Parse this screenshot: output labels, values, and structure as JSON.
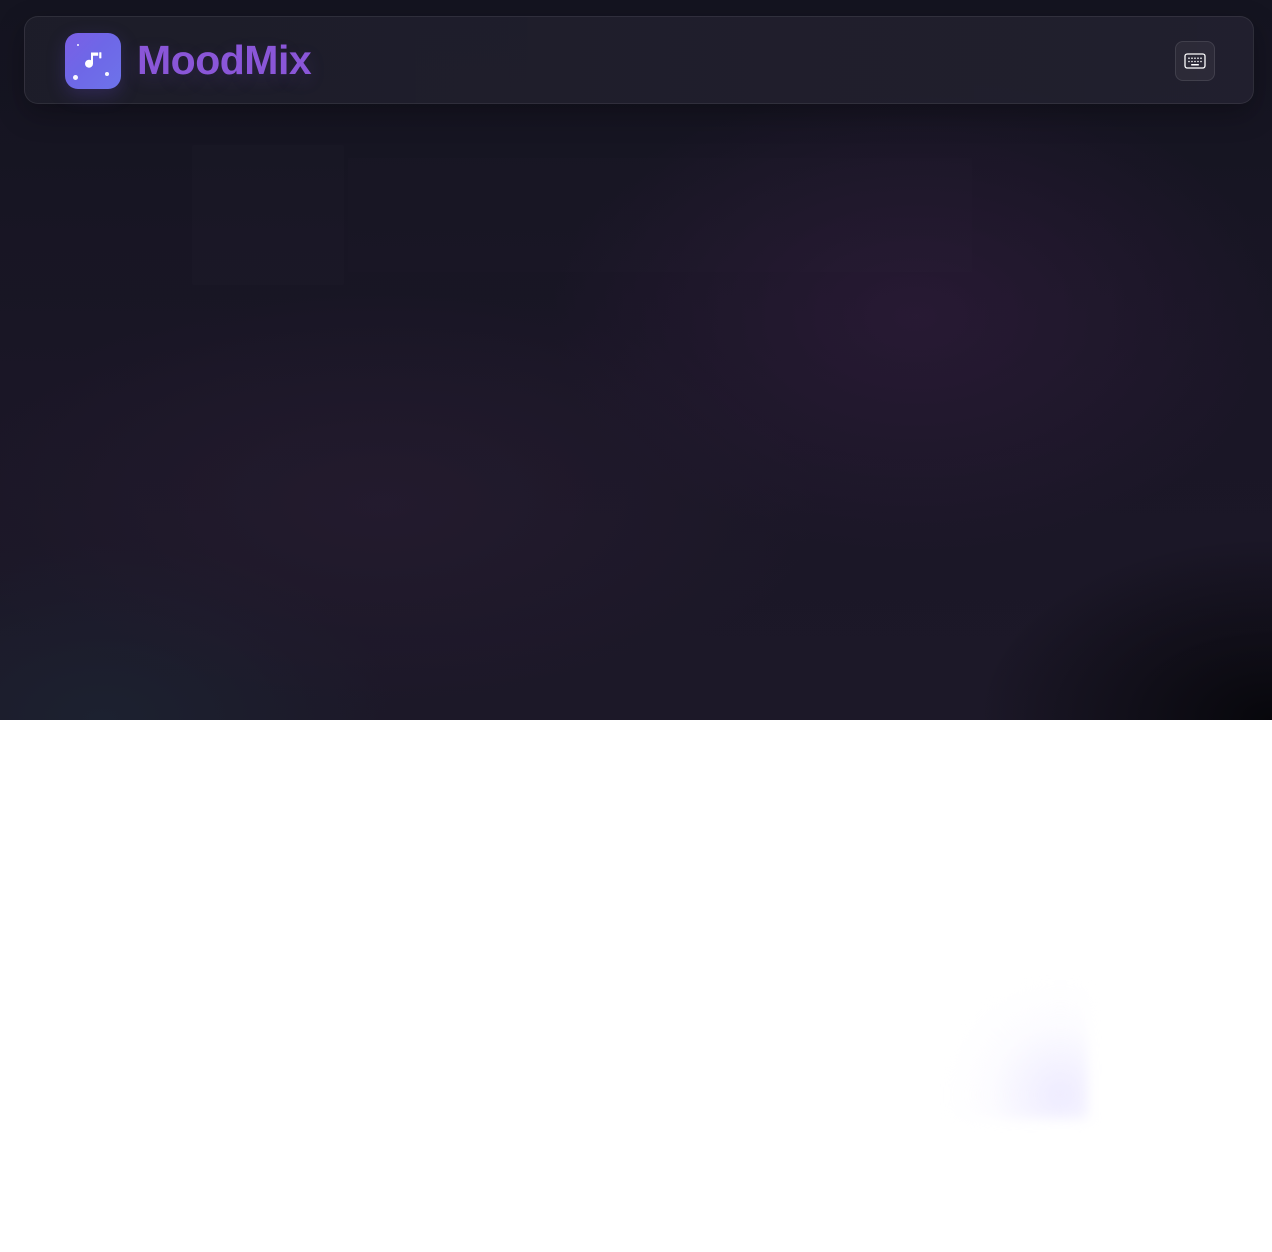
{
  "app": {
    "title": "MoodMix"
  },
  "header": {
    "logo_icon": "music-note-icon",
    "keyboard_icon": "keyboard-icon",
    "keyboard_button_label": ""
  },
  "colors": {
    "background_top": "#141420",
    "background_bottom": "#1c1828",
    "header_background": "#23202e",
    "brand_gradient_start": "#7b5fe6",
    "brand_gradient_end": "#6d73ea",
    "title_color": "#8a56d8",
    "page_background": "#ffffff"
  }
}
